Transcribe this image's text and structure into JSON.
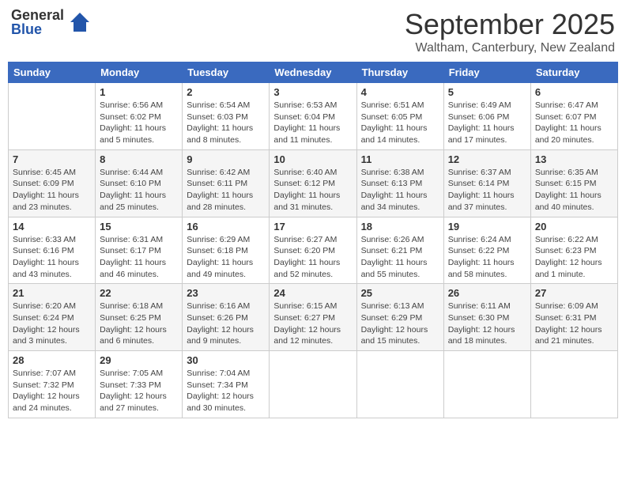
{
  "logo": {
    "general": "General",
    "blue": "Blue"
  },
  "header": {
    "month": "September 2025",
    "location": "Waltham, Canterbury, New Zealand"
  },
  "weekdays": [
    "Sunday",
    "Monday",
    "Tuesday",
    "Wednesday",
    "Thursday",
    "Friday",
    "Saturday"
  ],
  "weeks": [
    [
      {
        "day": "",
        "info": ""
      },
      {
        "day": "1",
        "info": "Sunrise: 6:56 AM\nSunset: 6:02 PM\nDaylight: 11 hours\nand 5 minutes."
      },
      {
        "day": "2",
        "info": "Sunrise: 6:54 AM\nSunset: 6:03 PM\nDaylight: 11 hours\nand 8 minutes."
      },
      {
        "day": "3",
        "info": "Sunrise: 6:53 AM\nSunset: 6:04 PM\nDaylight: 11 hours\nand 11 minutes."
      },
      {
        "day": "4",
        "info": "Sunrise: 6:51 AM\nSunset: 6:05 PM\nDaylight: 11 hours\nand 14 minutes."
      },
      {
        "day": "5",
        "info": "Sunrise: 6:49 AM\nSunset: 6:06 PM\nDaylight: 11 hours\nand 17 minutes."
      },
      {
        "day": "6",
        "info": "Sunrise: 6:47 AM\nSunset: 6:07 PM\nDaylight: 11 hours\nand 20 minutes."
      }
    ],
    [
      {
        "day": "7",
        "info": "Sunrise: 6:45 AM\nSunset: 6:09 PM\nDaylight: 11 hours\nand 23 minutes."
      },
      {
        "day": "8",
        "info": "Sunrise: 6:44 AM\nSunset: 6:10 PM\nDaylight: 11 hours\nand 25 minutes."
      },
      {
        "day": "9",
        "info": "Sunrise: 6:42 AM\nSunset: 6:11 PM\nDaylight: 11 hours\nand 28 minutes."
      },
      {
        "day": "10",
        "info": "Sunrise: 6:40 AM\nSunset: 6:12 PM\nDaylight: 11 hours\nand 31 minutes."
      },
      {
        "day": "11",
        "info": "Sunrise: 6:38 AM\nSunset: 6:13 PM\nDaylight: 11 hours\nand 34 minutes."
      },
      {
        "day": "12",
        "info": "Sunrise: 6:37 AM\nSunset: 6:14 PM\nDaylight: 11 hours\nand 37 minutes."
      },
      {
        "day": "13",
        "info": "Sunrise: 6:35 AM\nSunset: 6:15 PM\nDaylight: 11 hours\nand 40 minutes."
      }
    ],
    [
      {
        "day": "14",
        "info": "Sunrise: 6:33 AM\nSunset: 6:16 PM\nDaylight: 11 hours\nand 43 minutes."
      },
      {
        "day": "15",
        "info": "Sunrise: 6:31 AM\nSunset: 6:17 PM\nDaylight: 11 hours\nand 46 minutes."
      },
      {
        "day": "16",
        "info": "Sunrise: 6:29 AM\nSunset: 6:18 PM\nDaylight: 11 hours\nand 49 minutes."
      },
      {
        "day": "17",
        "info": "Sunrise: 6:27 AM\nSunset: 6:20 PM\nDaylight: 11 hours\nand 52 minutes."
      },
      {
        "day": "18",
        "info": "Sunrise: 6:26 AM\nSunset: 6:21 PM\nDaylight: 11 hours\nand 55 minutes."
      },
      {
        "day": "19",
        "info": "Sunrise: 6:24 AM\nSunset: 6:22 PM\nDaylight: 11 hours\nand 58 minutes."
      },
      {
        "day": "20",
        "info": "Sunrise: 6:22 AM\nSunset: 6:23 PM\nDaylight: 12 hours\nand 1 minute."
      }
    ],
    [
      {
        "day": "21",
        "info": "Sunrise: 6:20 AM\nSunset: 6:24 PM\nDaylight: 12 hours\nand 3 minutes."
      },
      {
        "day": "22",
        "info": "Sunrise: 6:18 AM\nSunset: 6:25 PM\nDaylight: 12 hours\nand 6 minutes."
      },
      {
        "day": "23",
        "info": "Sunrise: 6:16 AM\nSunset: 6:26 PM\nDaylight: 12 hours\nand 9 minutes."
      },
      {
        "day": "24",
        "info": "Sunrise: 6:15 AM\nSunset: 6:27 PM\nDaylight: 12 hours\nand 12 minutes."
      },
      {
        "day": "25",
        "info": "Sunrise: 6:13 AM\nSunset: 6:29 PM\nDaylight: 12 hours\nand 15 minutes."
      },
      {
        "day": "26",
        "info": "Sunrise: 6:11 AM\nSunset: 6:30 PM\nDaylight: 12 hours\nand 18 minutes."
      },
      {
        "day": "27",
        "info": "Sunrise: 6:09 AM\nSunset: 6:31 PM\nDaylight: 12 hours\nand 21 minutes."
      }
    ],
    [
      {
        "day": "28",
        "info": "Sunrise: 7:07 AM\nSunset: 7:32 PM\nDaylight: 12 hours\nand 24 minutes."
      },
      {
        "day": "29",
        "info": "Sunrise: 7:05 AM\nSunset: 7:33 PM\nDaylight: 12 hours\nand 27 minutes."
      },
      {
        "day": "30",
        "info": "Sunrise: 7:04 AM\nSunset: 7:34 PM\nDaylight: 12 hours\nand 30 minutes."
      },
      {
        "day": "",
        "info": ""
      },
      {
        "day": "",
        "info": ""
      },
      {
        "day": "",
        "info": ""
      },
      {
        "day": "",
        "info": ""
      }
    ]
  ]
}
